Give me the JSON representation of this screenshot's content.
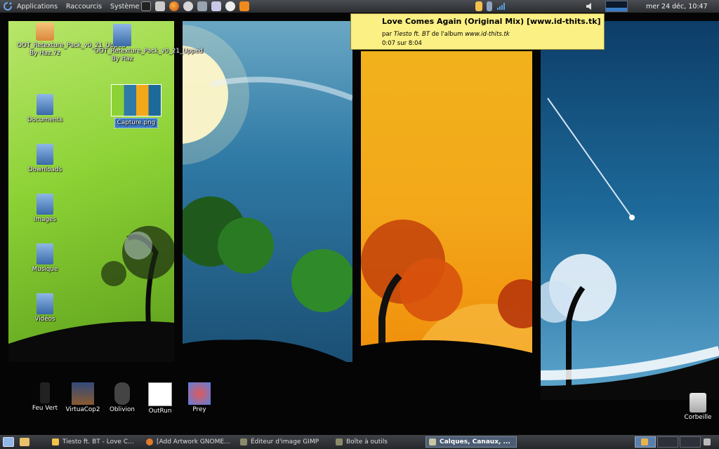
{
  "top_panel": {
    "menus": [
      "Applications",
      "Raccourcis",
      "Système"
    ],
    "clock": "mer 24 déc, 10:47"
  },
  "tooltip": {
    "title": "Love Comes Again (Original Mix) [www.id-thits.tk]",
    "by": "par",
    "artist": "Tiesto ft. BT",
    "album_prefix": "de l'album",
    "album": "www.id-thits.tk",
    "position": "0:07 sur 8:04"
  },
  "desktop_icons": {
    "file1": "OOT_Retexture_Pack_v0_21_Upped By Haz.7z",
    "file2": "OOT_Retexture_Pack_v0_21_Upped By Haz",
    "capture": "Capture.png",
    "documents": "Documents",
    "downloads": "Downloads",
    "images": "Images",
    "musique": "Musique",
    "videos": "Vidéos",
    "corbeille": "Corbeille"
  },
  "launchers": {
    "feu_vert": "Feu Vert",
    "virtuacop": "VirtuaCop2",
    "oblivion": "Oblivion",
    "outrun": "OutRun",
    "prey": "Prey"
  },
  "taskbar": {
    "tasks": [
      "Tiesto ft. BT - Love C...",
      "[Add Artwork GNOME...",
      "Éditeur d'image GIMP",
      "Boîte à outils",
      "Calques, Canaux, ..."
    ]
  },
  "colors": {
    "panel": "#2b2d31",
    "tooltip_bg": "#fbf084",
    "spring": "#8cd235",
    "summer_sky": "#2f7aa6",
    "autumn": "#f3a81a",
    "winter_sky": "#1d6a9a",
    "selection": "#3a78c3"
  }
}
